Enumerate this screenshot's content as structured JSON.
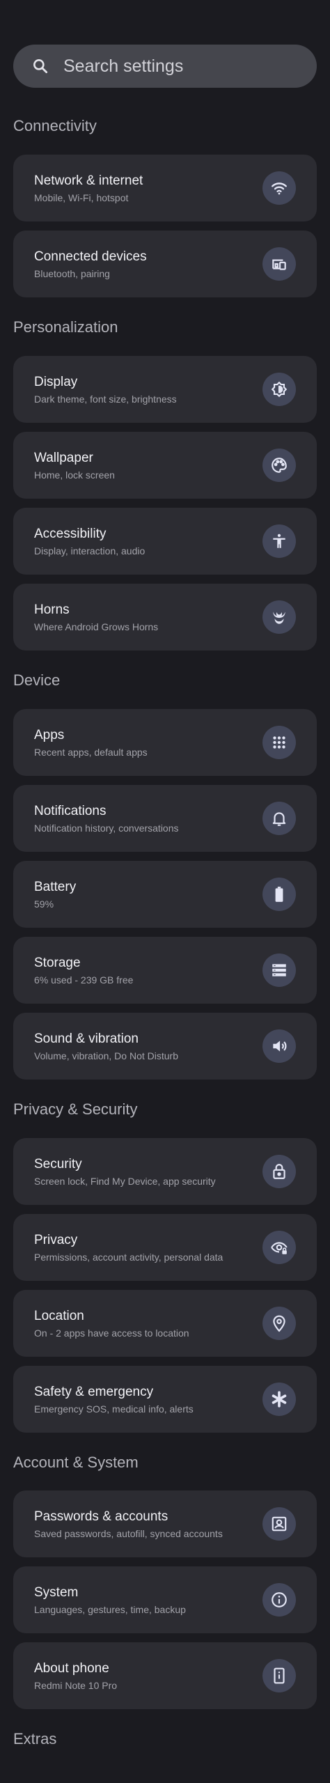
{
  "search": {
    "placeholder": "Search settings"
  },
  "sections": {
    "connectivity": "Connectivity",
    "personalization": "Personalization",
    "device": "Device",
    "privacy_security": "Privacy & Security",
    "account_system": "Account & System",
    "extras": "Extras"
  },
  "items": {
    "network": {
      "title": "Network & internet",
      "subtitle": "Mobile, Wi-Fi, hotspot",
      "icon": "wifi-icon"
    },
    "connected_devices": {
      "title": "Connected devices",
      "subtitle": "Bluetooth, pairing",
      "icon": "devices-icon"
    },
    "display": {
      "title": "Display",
      "subtitle": "Dark theme, font size, brightness",
      "icon": "brightness-icon"
    },
    "wallpaper": {
      "title": "Wallpaper",
      "subtitle": "Home, lock screen",
      "icon": "palette-icon"
    },
    "accessibility": {
      "title": "Accessibility",
      "subtitle": "Display, interaction, audio",
      "icon": "accessibility-icon"
    },
    "horns": {
      "title": "Horns",
      "subtitle": "Where Android Grows Horns",
      "icon": "horns-icon"
    },
    "apps": {
      "title": "Apps",
      "subtitle": "Recent apps, default apps",
      "icon": "apps-grid-icon"
    },
    "notifications": {
      "title": "Notifications",
      "subtitle": "Notification history, conversations",
      "icon": "bell-icon"
    },
    "battery": {
      "title": "Battery",
      "subtitle": "59%",
      "icon": "battery-icon"
    },
    "storage": {
      "title": "Storage",
      "subtitle": "6% used - 239 GB free",
      "icon": "storage-icon"
    },
    "sound": {
      "title": "Sound & vibration",
      "subtitle": "Volume, vibration, Do Not Disturb",
      "icon": "volume-icon"
    },
    "security": {
      "title": "Security",
      "subtitle": "Screen lock, Find My Device, app security",
      "icon": "lock-icon"
    },
    "privacy": {
      "title": "Privacy",
      "subtitle": "Permissions, account activity, personal data",
      "icon": "privacy-eye-icon"
    },
    "location": {
      "title": "Location",
      "subtitle": "On - 2 apps have access to location",
      "icon": "location-pin-icon"
    },
    "safety": {
      "title": "Safety & emergency",
      "subtitle": "Emergency SOS, medical info, alerts",
      "icon": "asterisk-icon"
    },
    "passwords": {
      "title": "Passwords & accounts",
      "subtitle": "Saved passwords, autofill, synced accounts",
      "icon": "account-box-icon"
    },
    "system": {
      "title": "System",
      "subtitle": "Languages, gestures, time, backup",
      "icon": "info-icon"
    },
    "about": {
      "title": "About phone",
      "subtitle": "Redmi Note 10 Pro",
      "icon": "phone-info-icon"
    }
  },
  "colors": {
    "background": "#1b1b20",
    "card": "#2c2c32",
    "icon_circle": "#43475a",
    "icon_glyph": "#e4e6f5"
  }
}
